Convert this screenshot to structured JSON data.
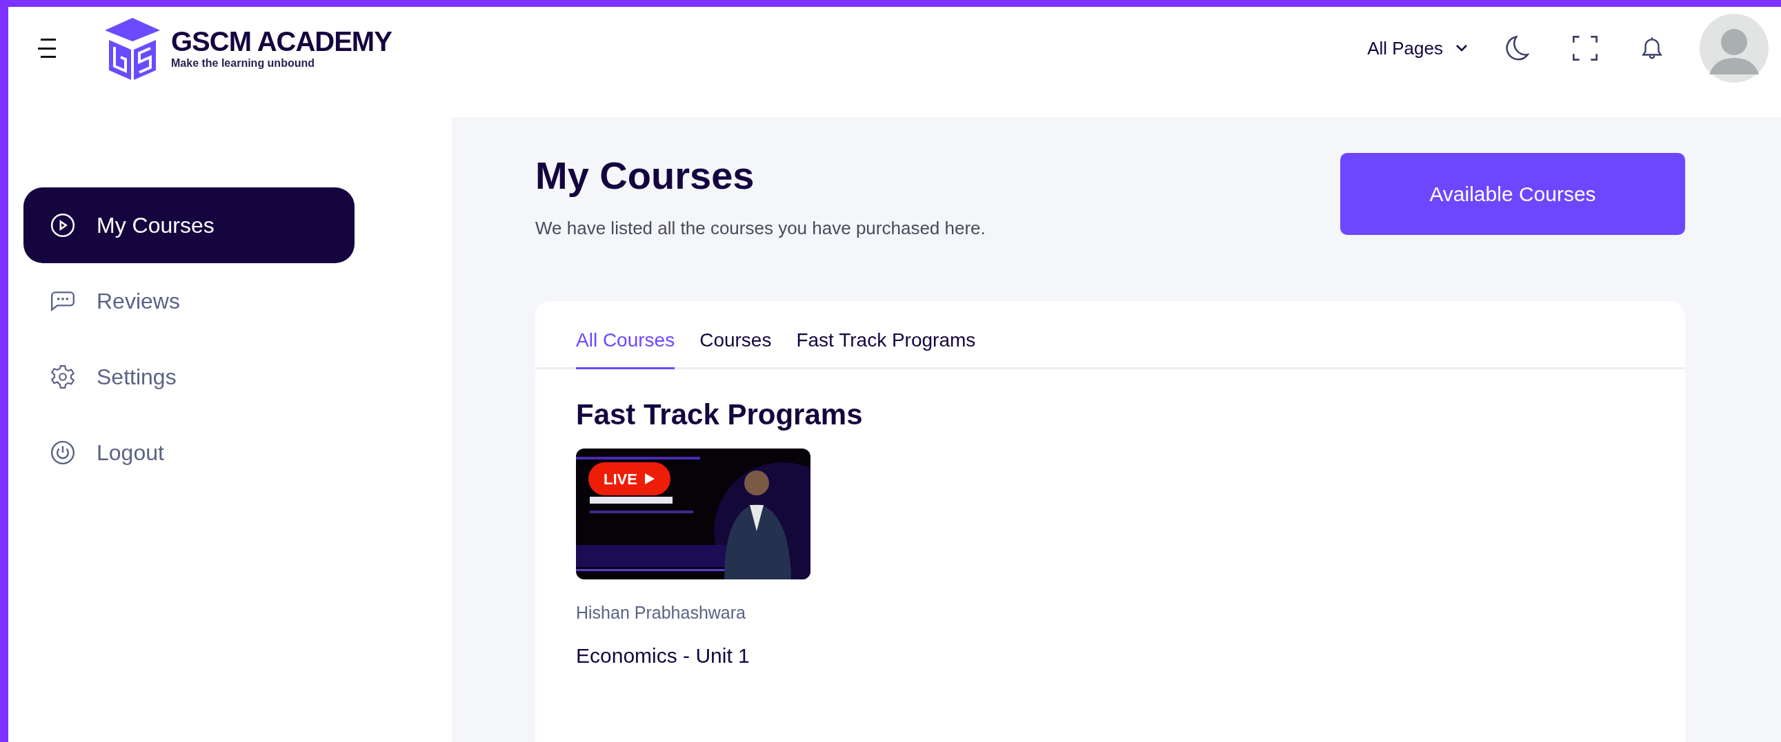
{
  "header": {
    "brand": "GSCM ACADEMY",
    "tagline": "Make the learning unbound",
    "pages_menu": "All Pages"
  },
  "sidebar": {
    "items": [
      {
        "label": "My Courses",
        "kind": "courses",
        "selected": true
      },
      {
        "label": "Reviews",
        "kind": "reviews",
        "selected": false
      },
      {
        "label": "Settings",
        "kind": "settings",
        "selected": false
      },
      {
        "label": "Logout",
        "kind": "logout",
        "selected": false
      }
    ]
  },
  "page": {
    "title": "My Courses",
    "subtitle": "We have listed all the courses you have purchased here.",
    "action": "Available Courses"
  },
  "tabs": [
    {
      "label": "All Courses",
      "selected": true
    },
    {
      "label": "Courses",
      "selected": false
    },
    {
      "label": "Fast Track Programs",
      "selected": false
    }
  ],
  "section": {
    "title": "Fast Track Programs",
    "courses": [
      {
        "kind": "picture",
        "badge": "LIVE",
        "author": "Hishan Prabhashwara",
        "title": "Economics - Unit 1"
      }
    ]
  }
}
